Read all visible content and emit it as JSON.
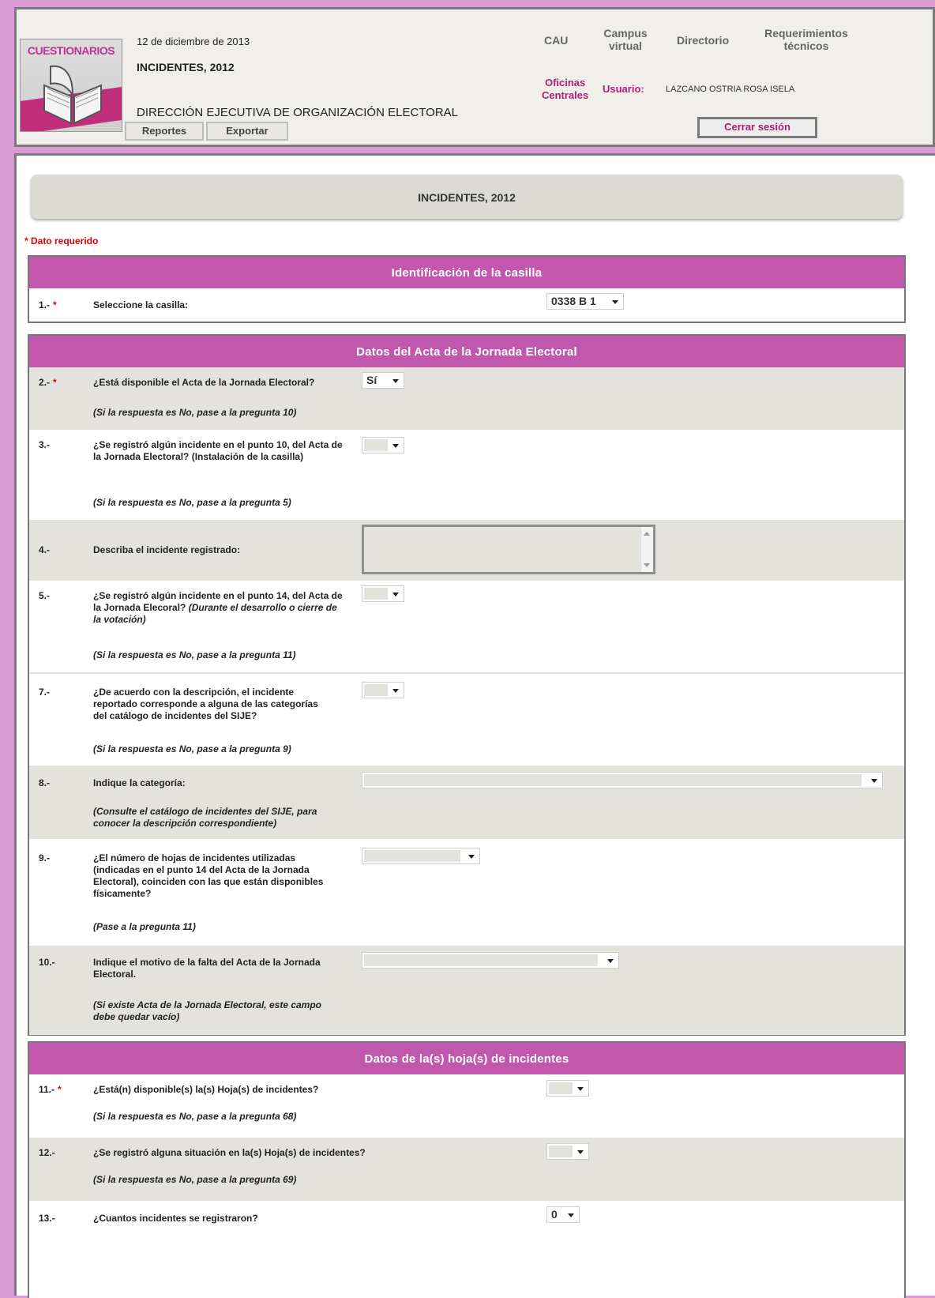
{
  "header": {
    "logo_text": "CUESTIONARIOS",
    "date": "12 de diciembre de 2013",
    "title": "INCIDENTES, 2012",
    "directorate": "DIRECCIÓN EJECUTIVA DE ORGANIZACIÓN ELECTORAL",
    "buttons": {
      "reports": "Reportes",
      "export": "Exportar"
    },
    "nav": {
      "cau": "CAU",
      "campus_line1": "Campus",
      "campus_line2": "virtual",
      "directory": "Directorio",
      "req_line1": "Requerimientos",
      "req_line2": "técnicos"
    },
    "office_line1": "Oficinas",
    "office_line2": "Centrales",
    "user_label": "Usuario:",
    "user_name": "LAZCANO OSTRIA ROSA ISELA",
    "logout": "Cerrar sesión"
  },
  "page_title": "INCIDENTES, 2012",
  "required_note": "* Dato requerido",
  "sections": {
    "s1": {
      "title": "Identificación de la casilla",
      "q1": {
        "num": "1.-",
        "star": "*",
        "text": "Seleccione la casilla:",
        "value": "0338 B 1"
      }
    },
    "s2": {
      "title": "Datos del Acta de la Jornada Electoral",
      "q2": {
        "num": "2.-",
        "star": "*",
        "text": "¿Está disponible el Acta de la Jornada Electoral?",
        "note": "(Si la respuesta es No, pase a la pregunta 10)",
        "value": "Sí"
      },
      "q3": {
        "num": "3.-",
        "text": "¿Se registró algún incidente en el punto 10, del Acta de la Jornada Electoral? (Instalación de la casilla)",
        "note": "(Si la respuesta es No, pase a la pregunta 5)"
      },
      "q4": {
        "num": "4.-",
        "text": "Describa el incidente registrado:"
      },
      "q5": {
        "num": "5.-",
        "text_a": "¿Se registró algún incidente en el punto 14, del Acta de la Jornada Elecoral? ",
        "text_b": "(Durante el desarrollo o cierre de la votación)",
        "note": "(Si la respuesta es No, pase a la pregunta 11)"
      },
      "q7": {
        "num": "7.-",
        "text": "¿De acuerdo con la descripción, el incidente reportado corresponde a alguna de las categorías del catálogo de incidentes del SIJE?",
        "note": "(Si la respuesta es No, pase a la pregunta 9)"
      },
      "q8": {
        "num": "8.-",
        "text": "Indique la categoría:",
        "note": "(Consulte el catálogo de incidentes del SIJE, para conocer la descripción correspondiente)"
      },
      "q9": {
        "num": "9.-",
        "text": "¿El número de hojas de incidentes utilizadas (indicadas en el punto 14 del Acta de la Jornada Electoral), coinciden con las que están disponibles físicamente?",
        "note": "(Pase a la pregunta 11)"
      },
      "q10": {
        "num": "10.-",
        "text": "Indique el motivo de la falta del Acta de la Jornada Electoral.",
        "note": "(Si existe Acta de la Jornada Electoral, este campo debe quedar vacío)"
      }
    },
    "s3": {
      "title": "Datos de la(s) hoja(s) de incidentes",
      "q11": {
        "num": "11.-",
        "star": "*",
        "text": "¿Está(n) disponible(s) la(s) Hoja(s) de incidentes?",
        "note": "(Si la respuesta es No, pase a la pregunta 68)"
      },
      "q12": {
        "num": "12.-",
        "text": "¿Se registró alguna situación en la(s) Hoja(s) de incidentes?",
        "note": "(Si la respuesta es No,  pase a la pregunta 69)"
      },
      "q13": {
        "num": "13.-",
        "text": "¿Cuantos incidentes se registraron?",
        "value": "0"
      }
    }
  },
  "colors": {
    "accent": "#c158ad",
    "page_bg": "#d99ad6",
    "required": "#e00000",
    "brand_text": "#b01e72"
  }
}
